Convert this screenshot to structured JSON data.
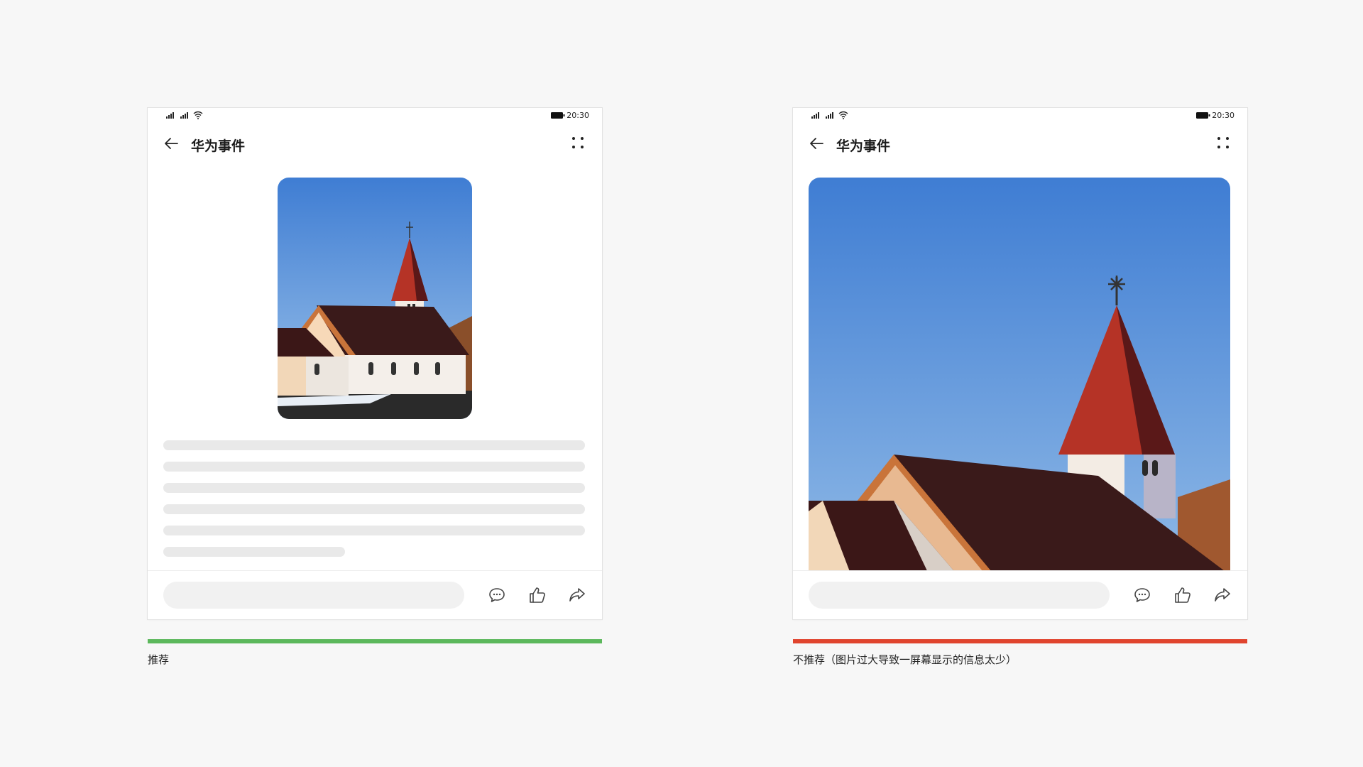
{
  "colors": {
    "background": "#f7f7f7",
    "recommended": "#5cb85c",
    "not_recommended": "#e0442e",
    "skeleton": "#e9e9e9",
    "input_bg": "#f1f1f1"
  },
  "panels": [
    {
      "status_time": "20:30",
      "title": "华为事件",
      "caption": "推荐"
    },
    {
      "status_time": "20:30",
      "title": "华为事件",
      "caption": "不推荐（图片过大导致一屏幕显示的信息太少）"
    }
  ],
  "icons": {
    "back": "arrow-left-icon",
    "more": "more-dots-icon",
    "comment": "comment-icon",
    "like": "thumbs-up-icon",
    "share": "share-icon",
    "signal": "signal-icon",
    "wifi": "wifi-icon",
    "battery": "battery-icon"
  }
}
